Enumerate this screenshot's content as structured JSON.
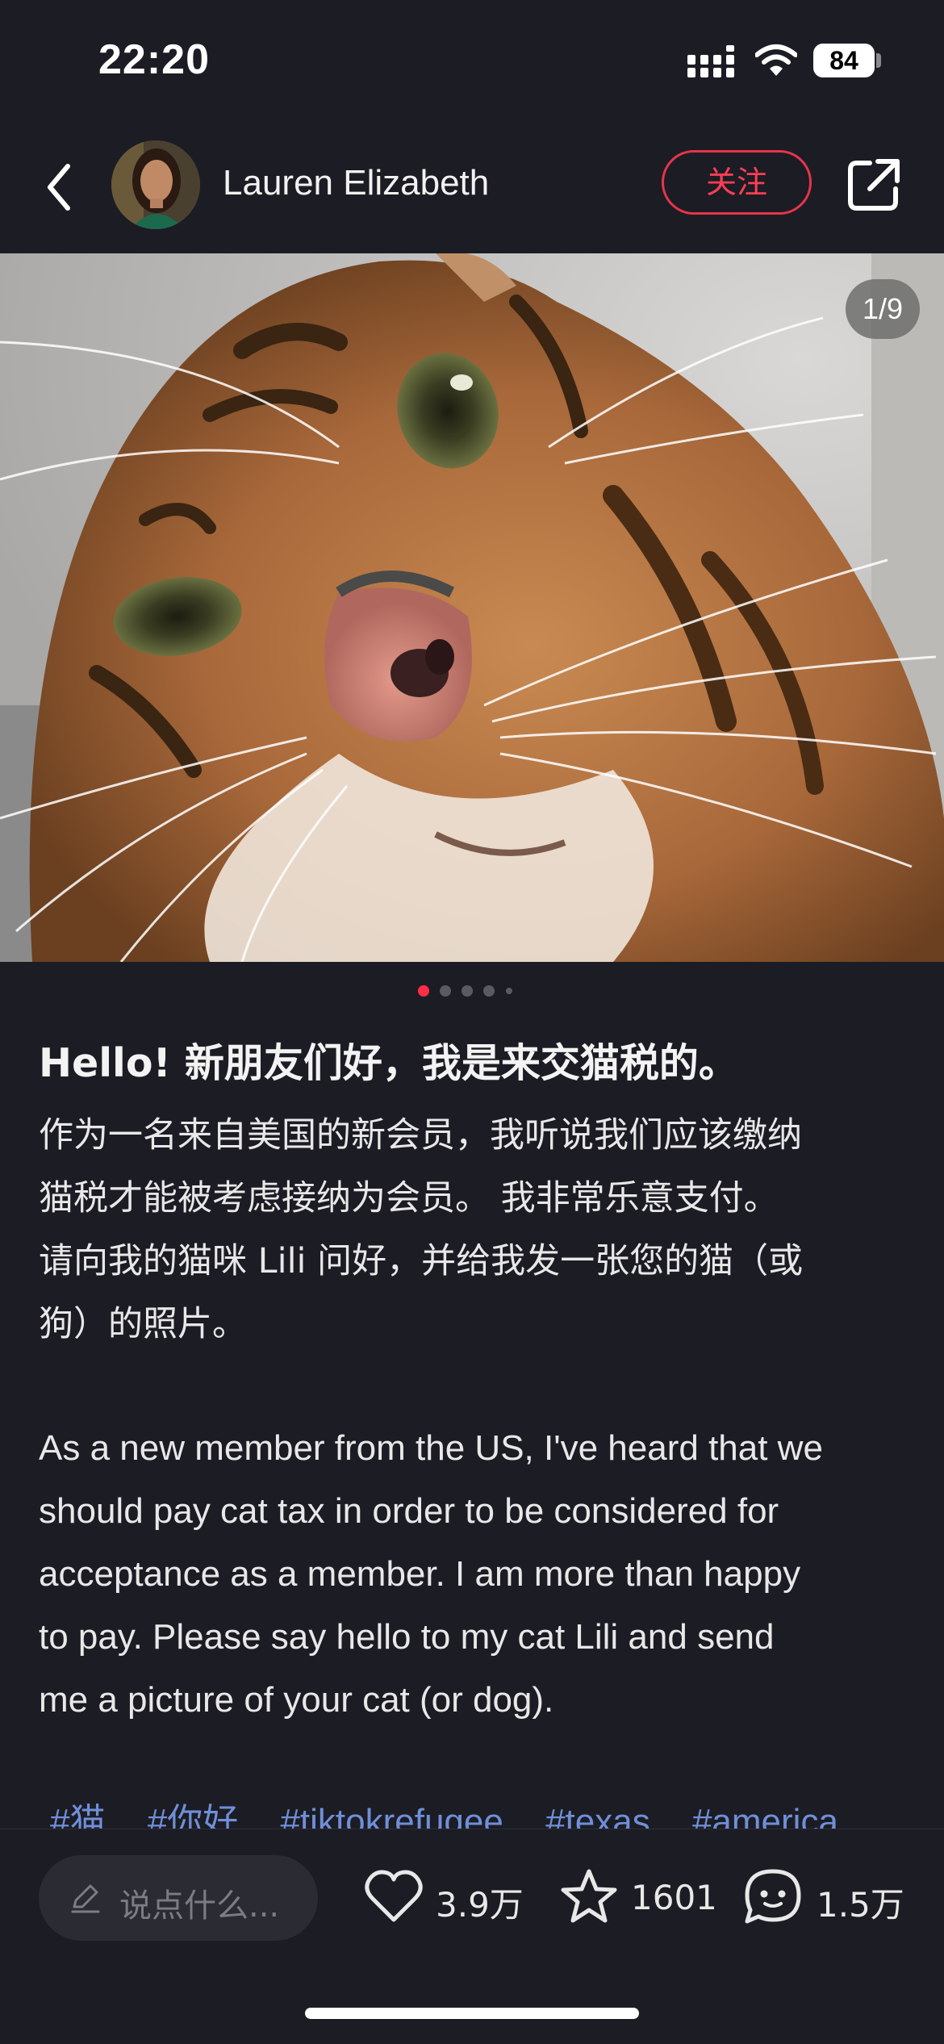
{
  "status_bar": {
    "time": "22:20",
    "battery": "84"
  },
  "header": {
    "author_name": "Lauren Elizabeth",
    "follow_label": "关注"
  },
  "photo": {
    "counter": "1/9",
    "dot_count": 5,
    "active_dot": 0
  },
  "post": {
    "title": "Hello! 新朋友们好，我是来交猫税的。",
    "body_cn": [
      "作为一名来自美国的新会员，我听说我们应该缴纳",
      "猫税才能被考虑接纳为会员。 我非常乐意支付。",
      "请向我的猫咪 Lili 问好，并给我发一张您的猫（或",
      "狗）的照片。"
    ],
    "body_en": [
      "As a new member from the US, I've heard that we",
      "should pay cat tax in order to be considered for",
      "acceptance as a member. I am more than happy",
      "to pay. Please say hello to my cat Lili and send",
      "me a picture of your cat (or dog)."
    ],
    "tags": [
      "#猫",
      "#你好",
      "#tiktokrefugee",
      "#texas",
      "#america"
    ]
  },
  "bottom_bar": {
    "comment_placeholder": "说点什么...",
    "likes": "3.9万",
    "favorites": "1601",
    "comments": "1.5万"
  },
  "colors": {
    "background": "#1c1c24",
    "accent": "#ff3e55",
    "tag": "#6f8fd8"
  }
}
